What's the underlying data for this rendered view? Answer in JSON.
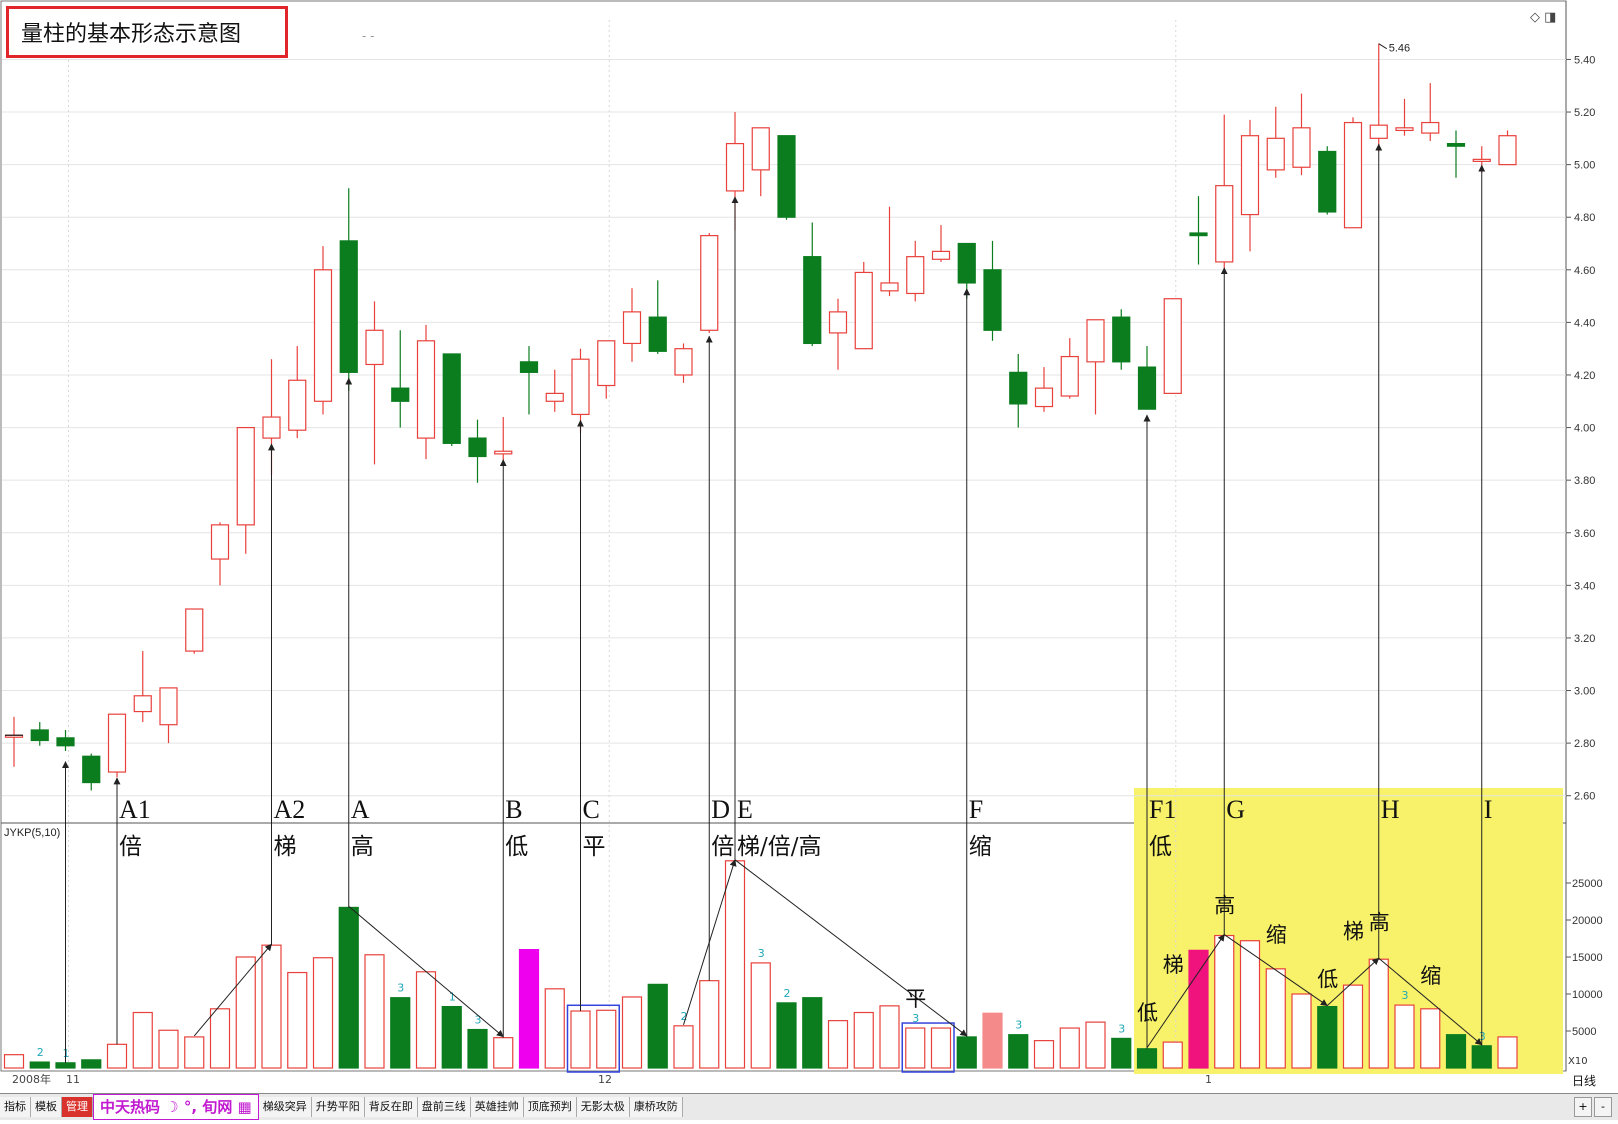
{
  "title": "量柱的基本形态示意图",
  "watermark": "- -",
  "indicator_label": "JYKP(5,10)",
  "period_label": "日线",
  "x10_label": "X10",
  "date_labels": [
    "2008年",
    "11",
    "12",
    "1"
  ],
  "peak_label": "5.46",
  "colors": {
    "up": "#e8413c",
    "down": "#0b7d1f",
    "grid": "#aaaaaa",
    "highlight": "#f7f26a",
    "magenta": "#ee00ee",
    "pink": "#f48a8a",
    "hotpink": "#f0137e",
    "blue_box": "#3344dd"
  },
  "tabs": [
    "指标",
    "模板",
    "管理",
    "梯级突异",
    "升势平阳",
    "背反在即",
    "盘前三线",
    "英雄挂帅",
    "顶底预判",
    "无影太极",
    "康桥攻防"
  ],
  "tab_logo": "中天热码 ☽ °, 旬网 ▦",
  "tab_right": [
    "+",
    "-"
  ],
  "chart_data": [
    {
      "type": "candlestick",
      "title": "",
      "ylim": [
        2.5,
        5.55
      ],
      "yticks": [
        2.6,
        2.8,
        3.0,
        3.2,
        3.4,
        3.6,
        3.8,
        4.0,
        4.2,
        4.4,
        4.6,
        4.8,
        5.0,
        5.2,
        5.4
      ],
      "candles": [
        {
          "o": 2.83,
          "h": 2.9,
          "l": 2.71,
          "c": 2.83
        },
        {
          "o": 2.85,
          "h": 2.88,
          "l": 2.79,
          "c": 2.81
        },
        {
          "o": 2.82,
          "h": 2.85,
          "l": 2.77,
          "c": 2.79
        },
        {
          "o": 2.75,
          "h": 2.76,
          "l": 2.62,
          "c": 2.65
        },
        {
          "o": 2.69,
          "h": 2.91,
          "l": 2.67,
          "c": 2.91
        },
        {
          "o": 2.92,
          "h": 3.15,
          "l": 2.88,
          "c": 2.98
        },
        {
          "o": 2.87,
          "h": 3.01,
          "l": 2.8,
          "c": 3.01
        },
        {
          "o": 3.15,
          "h": 3.31,
          "l": 3.14,
          "c": 3.31
        },
        {
          "o": 3.5,
          "h": 3.64,
          "l": 3.4,
          "c": 3.63
        },
        {
          "o": 3.63,
          "h": 4.0,
          "l": 3.52,
          "c": 4.0
        },
        {
          "o": 3.96,
          "h": 4.26,
          "l": 3.82,
          "c": 4.04
        },
        {
          "o": 3.99,
          "h": 4.31,
          "l": 3.96,
          "c": 4.18
        },
        {
          "o": 4.1,
          "h": 4.69,
          "l": 4.05,
          "c": 4.6
        },
        {
          "o": 4.71,
          "h": 4.91,
          "l": 4.14,
          "c": 4.21
        },
        {
          "o": 4.24,
          "h": 4.48,
          "l": 3.86,
          "c": 4.37
        },
        {
          "o": 4.15,
          "h": 4.37,
          "l": 4.0,
          "c": 4.1
        },
        {
          "o": 3.96,
          "h": 4.39,
          "l": 3.88,
          "c": 4.33
        },
        {
          "o": 4.28,
          "h": 4.28,
          "l": 3.93,
          "c": 3.94
        },
        {
          "o": 3.96,
          "h": 4.03,
          "l": 3.79,
          "c": 3.89
        },
        {
          "o": 3.9,
          "h": 4.04,
          "l": 3.86,
          "c": 3.91
        },
        {
          "o": 4.25,
          "h": 4.31,
          "l": 4.05,
          "c": 4.21
        },
        {
          "o": 4.1,
          "h": 4.22,
          "l": 4.06,
          "c": 4.13
        },
        {
          "o": 4.05,
          "h": 4.3,
          "l": 3.98,
          "c": 4.26
        },
        {
          "o": 4.16,
          "h": 4.33,
          "l": 4.11,
          "c": 4.33
        },
        {
          "o": 4.32,
          "h": 4.53,
          "l": 4.25,
          "c": 4.44
        },
        {
          "o": 4.42,
          "h": 4.56,
          "l": 4.28,
          "c": 4.29
        },
        {
          "o": 4.2,
          "h": 4.32,
          "l": 4.17,
          "c": 4.3
        },
        {
          "o": 4.37,
          "h": 4.74,
          "l": 4.36,
          "c": 4.73
        },
        {
          "o": 4.9,
          "h": 5.2,
          "l": 4.75,
          "c": 5.08
        },
        {
          "o": 4.98,
          "h": 5.14,
          "l": 4.88,
          "c": 5.14
        },
        {
          "o": 5.11,
          "h": 5.11,
          "l": 4.79,
          "c": 4.8
        },
        {
          "o": 4.65,
          "h": 4.78,
          "l": 4.31,
          "c": 4.32
        },
        {
          "o": 4.36,
          "h": 4.49,
          "l": 4.22,
          "c": 4.44
        },
        {
          "o": 4.3,
          "h": 4.63,
          "l": 4.3,
          "c": 4.59
        },
        {
          "o": 4.52,
          "h": 4.84,
          "l": 4.5,
          "c": 4.55
        },
        {
          "o": 4.51,
          "h": 4.71,
          "l": 4.48,
          "c": 4.65
        },
        {
          "o": 4.64,
          "h": 4.77,
          "l": 4.63,
          "c": 4.67
        },
        {
          "o": 4.7,
          "h": 4.7,
          "l": 4.49,
          "c": 4.55
        },
        {
          "o": 4.6,
          "h": 4.71,
          "l": 4.33,
          "c": 4.37
        },
        {
          "o": 4.21,
          "h": 4.28,
          "l": 4.0,
          "c": 4.09
        },
        {
          "o": 4.08,
          "h": 4.23,
          "l": 4.06,
          "c": 4.15
        },
        {
          "o": 4.12,
          "h": 4.34,
          "l": 4.11,
          "c": 4.27
        },
        {
          "o": 4.25,
          "h": 4.41,
          "l": 4.05,
          "c": 4.41
        },
        {
          "o": 4.42,
          "h": 4.45,
          "l": 4.22,
          "c": 4.25
        },
        {
          "o": 4.23,
          "h": 4.31,
          "l": 4.07,
          "c": 4.07
        },
        {
          "o": 4.13,
          "h": 4.49,
          "l": 4.13,
          "c": 4.49
        },
        {
          "o": 4.74,
          "h": 4.88,
          "l": 4.62,
          "c": 4.73
        },
        {
          "o": 4.63,
          "h": 5.19,
          "l": 4.6,
          "c": 4.92
        },
        {
          "o": 4.81,
          "h": 5.17,
          "l": 4.67,
          "c": 5.11
        },
        {
          "o": 4.98,
          "h": 5.22,
          "l": 4.95,
          "c": 5.1
        },
        {
          "o": 4.99,
          "h": 5.27,
          "l": 4.96,
          "c": 5.14
        },
        {
          "o": 5.05,
          "h": 5.07,
          "l": 4.81,
          "c": 4.82
        },
        {
          "o": 4.76,
          "h": 5.18,
          "l": 4.76,
          "c": 5.16
        },
        {
          "o": 5.1,
          "h": 5.46,
          "l": 5.05,
          "c": 5.15
        },
        {
          "o": 5.13,
          "h": 5.25,
          "l": 5.11,
          "c": 5.14
        },
        {
          "o": 5.12,
          "h": 5.31,
          "l": 5.09,
          "c": 5.16
        },
        {
          "o": 5.08,
          "h": 5.13,
          "l": 4.95,
          "c": 5.07
        },
        {
          "o": 5.02,
          "h": 5.07,
          "l": 4.97,
          "c": 5.02
        },
        {
          "o": 5.0,
          "h": 5.13,
          "l": 5.0,
          "c": 5.11
        }
      ]
    },
    {
      "type": "bar",
      "title": "JYKP(5,10)",
      "ylim": [
        0,
        30000
      ],
      "yticks": [
        5000,
        10000,
        15000,
        20000,
        25000
      ],
      "volumes": [
        {
          "v": 1800,
          "d": 0
        },
        {
          "v": 800,
          "d": 1,
          "n": "2"
        },
        {
          "v": 700,
          "d": 1,
          "n": "1"
        },
        {
          "v": 1100,
          "d": 1
        },
        {
          "v": 3200,
          "d": 0
        },
        {
          "v": 7500,
          "d": 0
        },
        {
          "v": 5100,
          "d": 0
        },
        {
          "v": 4200,
          "d": 0
        },
        {
          "v": 8000,
          "d": 0
        },
        {
          "v": 15000,
          "d": 0
        },
        {
          "v": 16600,
          "d": 0
        },
        {
          "v": 12900,
          "d": 0
        },
        {
          "v": 14900,
          "d": 0
        },
        {
          "v": 21700,
          "d": 1
        },
        {
          "v": 15300,
          "d": 0
        },
        {
          "v": 9500,
          "d": 1,
          "n": "3"
        },
        {
          "v": 13000,
          "d": 0
        },
        {
          "v": 8300,
          "d": 1,
          "n": "1"
        },
        {
          "v": 5200,
          "d": 1,
          "n": "3"
        },
        {
          "v": 4100,
          "d": 0
        },
        {
          "v": 16000,
          "d": 0,
          "c": "magenta"
        },
        {
          "v": 10700,
          "d": 0
        },
        {
          "v": 7700,
          "d": 0
        },
        {
          "v": 7800,
          "d": 0
        },
        {
          "v": 9600,
          "d": 0
        },
        {
          "v": 11300,
          "d": 1
        },
        {
          "v": 5700,
          "d": 0,
          "n": "2"
        },
        {
          "v": 11800,
          "d": 0
        },
        {
          "v": 28000,
          "d": 0
        },
        {
          "v": 14200,
          "d": 0,
          "n": "3"
        },
        {
          "v": 8800,
          "d": 1,
          "n": "2"
        },
        {
          "v": 9500,
          "d": 1
        },
        {
          "v": 6400,
          "d": 0
        },
        {
          "v": 7500,
          "d": 0
        },
        {
          "v": 8400,
          "d": 0
        },
        {
          "v": 5400,
          "d": 0,
          "n": "3"
        },
        {
          "v": 5400,
          "d": 0
        },
        {
          "v": 4200,
          "d": 1
        },
        {
          "v": 7400,
          "d": 0,
          "c": "pink"
        },
        {
          "v": 4500,
          "d": 1,
          "n": "3"
        },
        {
          "v": 3700,
          "d": 0
        },
        {
          "v": 5400,
          "d": 0
        },
        {
          "v": 6200,
          "d": 0
        },
        {
          "v": 4000,
          "d": 1,
          "n": "3"
        },
        {
          "v": 2600,
          "d": 1
        },
        {
          "v": 3500,
          "d": 0
        },
        {
          "v": 15900,
          "d": 0,
          "c": "hotpink"
        },
        {
          "v": 17900,
          "d": 0
        },
        {
          "v": 17200,
          "d": 0
        },
        {
          "v": 13400,
          "d": 0
        },
        {
          "v": 10000,
          "d": 0
        },
        {
          "v": 8300,
          "d": 1
        },
        {
          "v": 11200,
          "d": 0
        },
        {
          "v": 14700,
          "d": 0
        },
        {
          "v": 8500,
          "d": 0,
          "n": "3"
        },
        {
          "v": 8000,
          "d": 0
        },
        {
          "v": 4500,
          "d": 1
        },
        {
          "v": 3000,
          "d": 1,
          "n": "3"
        },
        {
          "v": 4200,
          "d": 0
        }
      ]
    }
  ],
  "annotations": {
    "markers": [
      {
        "i": 4,
        "label": "A1",
        "sub": "倍"
      },
      {
        "i": 10,
        "label": "A2",
        "sub": "梯"
      },
      {
        "i": 13,
        "label": "A",
        "sub": "高"
      },
      {
        "i": 19,
        "label": "B",
        "sub": "低"
      },
      {
        "i": 22,
        "label": "C",
        "sub": "平"
      },
      {
        "i": 27,
        "label": "D",
        "sub": "倍"
      },
      {
        "i": 28,
        "label": "E",
        "sub": "梯/倍/高"
      },
      {
        "i": 37,
        "label": "F",
        "sub": "缩"
      },
      {
        "i": 44,
        "label": "F1",
        "sub": "低"
      },
      {
        "i": 47,
        "label": "G",
        "sub": ""
      },
      {
        "i": 53,
        "label": "H",
        "sub": ""
      },
      {
        "i": 57,
        "label": "I",
        "sub": ""
      }
    ],
    "extra_arrow_bars": [
      2
    ],
    "zone_words": [
      {
        "text": "低",
        "i": 44,
        "v": 6500
      },
      {
        "text": "梯",
        "i": 45,
        "v": 13000
      },
      {
        "text": "高",
        "i": 47,
        "v": 21000
      },
      {
        "text": "缩",
        "i": 49,
        "v": 17000
      },
      {
        "text": "低",
        "i": 51,
        "v": 11000
      },
      {
        "text": "梯",
        "i": 52,
        "v": 17500
      },
      {
        "text": "高",
        "i": 53,
        "v": 18700
      },
      {
        "text": "缩",
        "i": 55,
        "v": 11500
      },
      {
        "text": "平",
        "i": 35,
        "v": 8400
      }
    ],
    "trend_arrows": [
      {
        "from": 7,
        "to": 10
      },
      {
        "from": 13,
        "to": 19
      },
      {
        "from": 26,
        "to": 28
      },
      {
        "from": 28,
        "to": 37
      },
      {
        "from": 44,
        "to": 47
      },
      {
        "from": 47,
        "to": 51
      },
      {
        "from": 51,
        "to": 53
      },
      {
        "from": 53,
        "to": 57
      }
    ],
    "blue_boxes": [
      [
        22,
        23
      ],
      [
        35,
        36
      ]
    ]
  }
}
